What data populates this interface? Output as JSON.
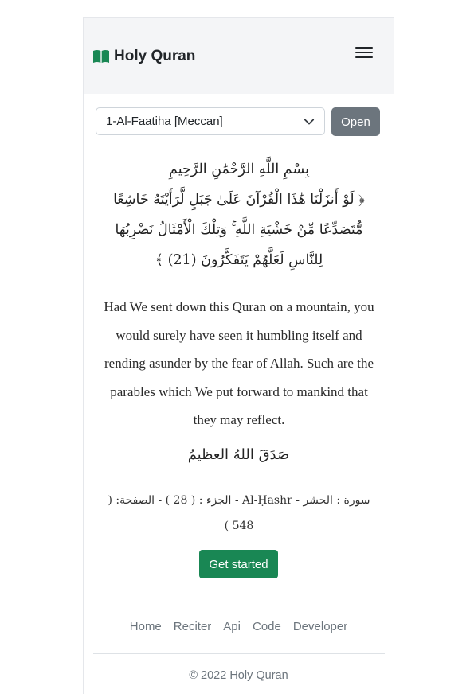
{
  "navbar": {
    "brand": "Holy Quran",
    "brand_icon": "book-icon",
    "menu_icon": "hamburger-icon",
    "brand_color": "#198754"
  },
  "picker": {
    "selected": "1-Al-Faatiha [Meccan]",
    "open_label": "Open"
  },
  "verse": {
    "basmala": "بِسْمِ اللَّهِ الرَّحْمَٰنِ الرَّحِيمِ",
    "arabic": "﴿ لَوْ أَنزَلْنَا هَٰذَا الْقُرْآنَ عَلَىٰ جَبَلٍ لَّرَأَيْتَهُ خَاشِعًا مُّتَصَدِّعًا مِّنْ خَشْيَةِ اللَّهِ ۚ وَتِلْكَ الْأَمْثَالُ نَضْرِبُهَا لِلنَّاسِ لَعَلَّهُمْ يَتَفَكَّرُونَ (21) ﴾",
    "translation": "Had We sent down this Quran on a mountain, you would surely have seen it humbling itself and rending asunder by the fear of Allah. Such are the parables which We put forward to mankind that they may reflect.",
    "closing": "صَدَقَ اللهُ العظيمُ",
    "meta": "سورة : الحشر - Al-Ḥashr - الجزء : ( 28 ) - الصفحة: ( 548 )"
  },
  "cta": {
    "label": "Get started",
    "color": "#198754"
  },
  "footer": {
    "links": [
      "Home",
      "Reciter",
      "Api",
      "Code",
      "Developer"
    ],
    "copyright": "© 2022 Holy Quran"
  }
}
